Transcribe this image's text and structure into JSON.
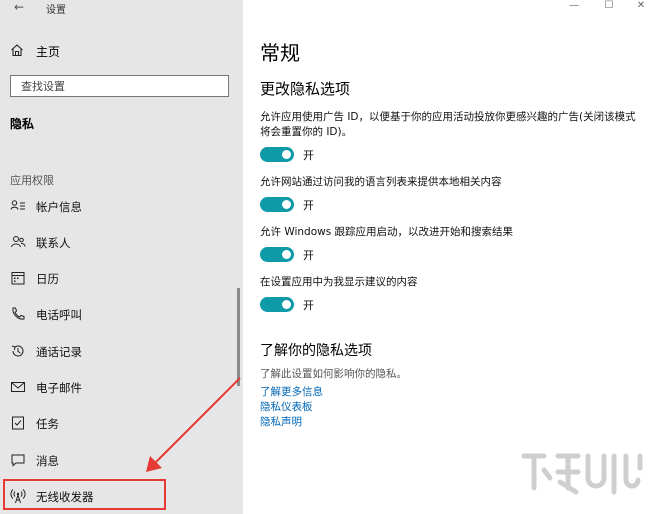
{
  "window": {
    "back_glyph": "←",
    "title": "设置",
    "minimize_glyph": "—",
    "maximize_glyph": "☐",
    "close_glyph": "✕"
  },
  "sidebar": {
    "home_label": "主页",
    "search_placeholder": "查找设置",
    "section_title": "隐私",
    "group_title": "应用权限",
    "items": [
      {
        "label": "帐户信息",
        "icon": "account-info-icon"
      },
      {
        "label": "联系人",
        "icon": "contacts-icon"
      },
      {
        "label": "日历",
        "icon": "calendar-icon"
      },
      {
        "label": "电话呼叫",
        "icon": "phone-icon"
      },
      {
        "label": "通话记录",
        "icon": "call-history-icon"
      },
      {
        "label": "电子邮件",
        "icon": "email-icon"
      },
      {
        "label": "任务",
        "icon": "tasks-icon"
      },
      {
        "label": "消息",
        "icon": "message-icon"
      },
      {
        "label": "无线收发器",
        "icon": "radio-icon"
      }
    ]
  },
  "main": {
    "page_title": "常规",
    "sub_title": "更改隐私选项",
    "options": [
      {
        "description": "允许应用使用广告 ID，以便基于你的应用活动投放你更感兴趣的广告(关闭该模式将会重置你的 ID)。",
        "state": "开"
      },
      {
        "description": "允许网站通过访问我的语言列表来提供本地相关内容",
        "state": "开"
      },
      {
        "description": "允许 Windows 跟踪应用启动，以改进开始和搜索结果",
        "state": "开"
      },
      {
        "description": "在设置应用中为我显示建议的内容",
        "state": "开"
      }
    ],
    "learn_title": "了解你的隐私选项",
    "learn_desc": "了解此设置如何影响你的隐私。",
    "links": [
      "了解更多信息",
      "隐私仪表板",
      "隐私声明"
    ]
  },
  "colors": {
    "toggle_on": "#0e9aa7",
    "link": "#0067b8",
    "highlight": "#e53935",
    "sidebar_bg": "#e6e6e6"
  }
}
